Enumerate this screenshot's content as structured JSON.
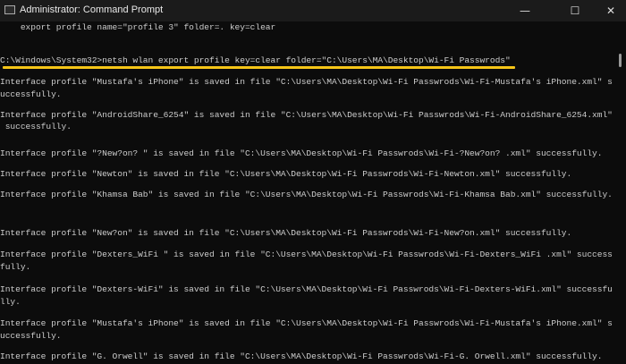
{
  "window": {
    "title": "Administrator: Command Prompt",
    "app_icon": "cmd-icon",
    "controls": {
      "minimize": "—",
      "maximize": "☐",
      "close": "✕"
    }
  },
  "terminal": {
    "lines": [
      "    export profile name=\"profile 3\" folder=. key=clear",
      "C:\\Windows\\System32>netsh wlan export profile key=clear folder=\"C:\\Users\\MA\\Desktop\\Wi-Fi Passwrods\"",
      "Interface profile \"Mustafa's iPhone\" is saved in file \"C:\\Users\\MA\\Desktop\\Wi-Fi Passwrods\\Wi-Fi-Mustafa's iPhone.xml\" s",
      "uccessfully.",
      "Interface profile \"AndroidShare_6254\" is saved in file \"C:\\Users\\MA\\Desktop\\Wi-Fi Passwrods\\Wi-Fi-AndroidShare_6254.xml\"",
      " successfully.",
      "Interface profile \"?New?on? \" is saved in file \"C:\\Users\\MA\\Desktop\\Wi-Fi Passwrods\\Wi-Fi-?New?on? .xml\" successfully.",
      "Interface profile \"Newton\" is saved in file \"C:\\Users\\MA\\Desktop\\Wi-Fi Passwrods\\Wi-Fi-Newton.xml\" successfully.",
      "Interface profile \"Khamsa Bab\" is saved in file \"C:\\Users\\MA\\Desktop\\Wi-Fi Passwrods\\Wi-Fi-Khamsa Bab.xml\" successfully.",
      "Interface profile \"New?on\" is saved in file \"C:\\Users\\MA\\Desktop\\Wi-Fi Passwrods\\Wi-Fi-New?on.xml\" successfully.",
      "Interface profile \"Dexters_WiFi \" is saved in file \"C:\\Users\\MA\\Desktop\\Wi-Fi Passwrods\\Wi-Fi-Dexters_WiFi .xml\" success",
      "fully.",
      "Interface profile \"Dexters-WiFi\" is saved in file \"C:\\Users\\MA\\Desktop\\Wi-Fi Passwrods\\Wi-Fi-Dexters-WiFi.xml\" successfu",
      "lly.",
      "Interface profile \"Mustafa's iPhone\" is saved in file \"C:\\Users\\MA\\Desktop\\Wi-Fi Passwrods\\Wi-Fi-Mustafa's iPhone.xml\" s",
      "uccessfully.",
      "Interface profile \"G. Orwell\" is saved in file \"C:\\Users\\MA\\Desktop\\Wi-Fi Passwrods\\Wi-Fi-G. Orwell.xml\" successfully."
    ]
  },
  "colors": {
    "highlight": "#f5c518",
    "background": "#0c0c0c",
    "text": "#cccccc"
  }
}
